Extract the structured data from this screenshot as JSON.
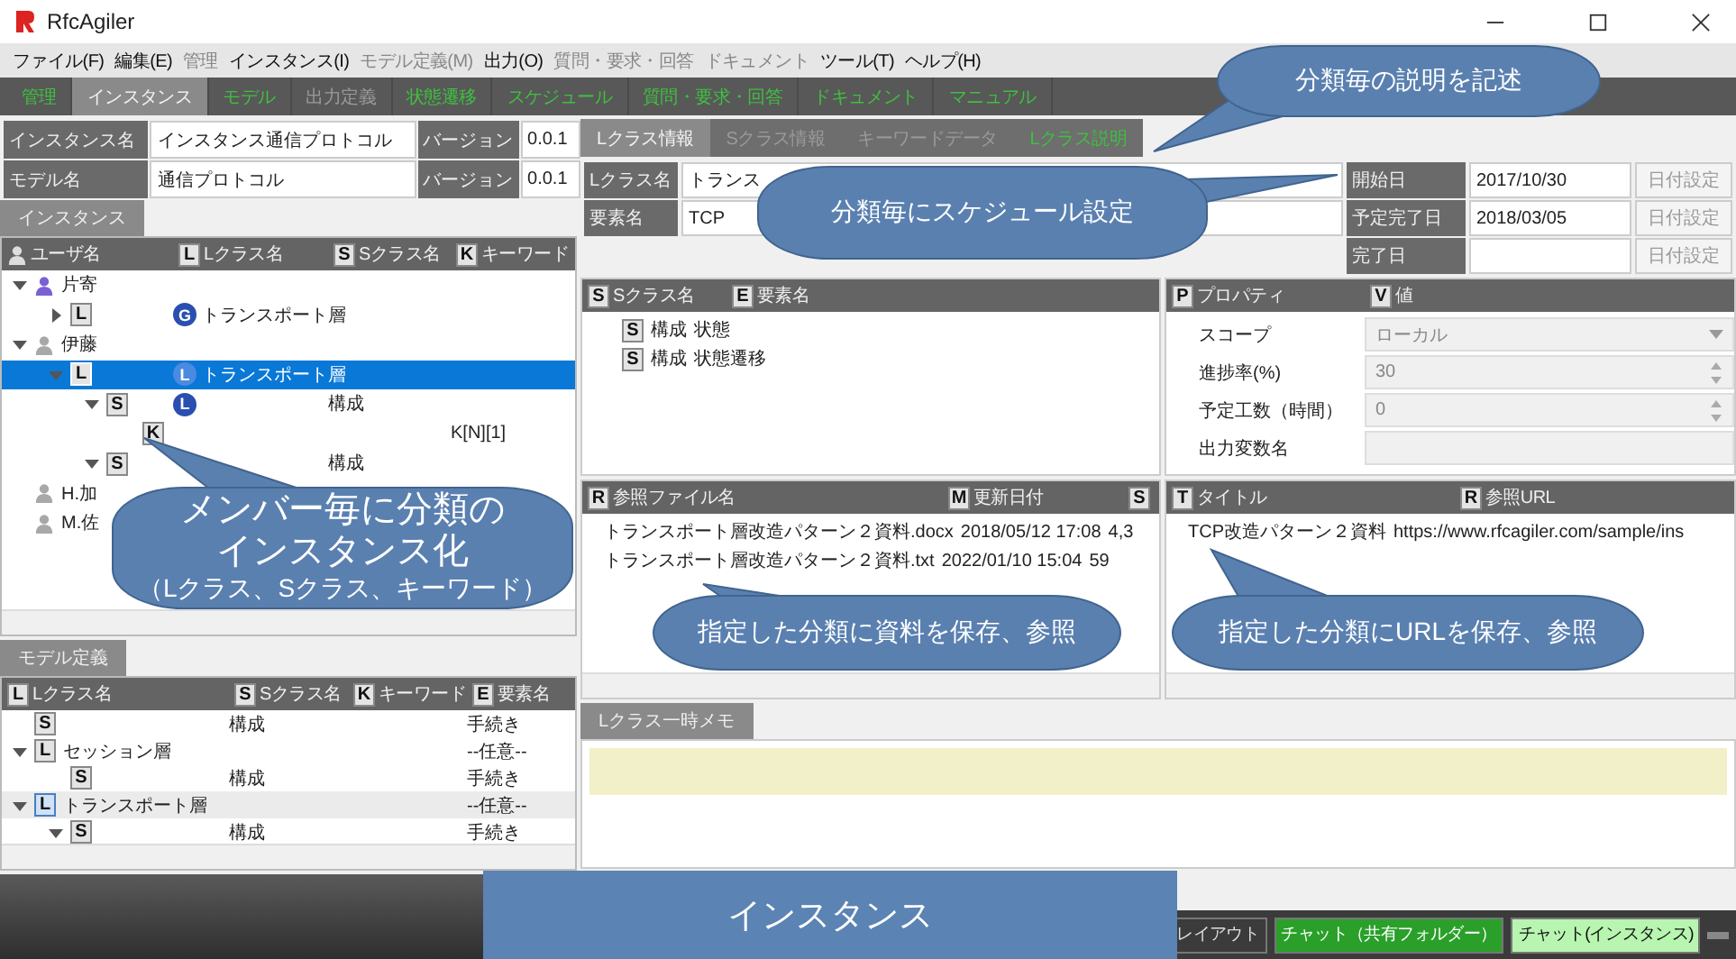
{
  "window": {
    "title": "RfcAgiler"
  },
  "menu": [
    {
      "label": "ファイル(F)",
      "disabled": false
    },
    {
      "label": "編集(E)",
      "disabled": false
    },
    {
      "label": "管理",
      "disabled": true
    },
    {
      "label": "インスタンス(I)",
      "disabled": false
    },
    {
      "label": "モデル定義(M)",
      "disabled": true
    },
    {
      "label": "出力(O)",
      "disabled": false
    },
    {
      "label": "質問・要求・回答",
      "disabled": true
    },
    {
      "label": "ドキュメント",
      "disabled": true
    },
    {
      "label": "ツール(T)",
      "disabled": false
    },
    {
      "label": "ヘルプ(H)",
      "disabled": false
    }
  ],
  "module_tabs": [
    {
      "label": "管理",
      "selected": false,
      "disabled": false
    },
    {
      "label": "インスタンス",
      "selected": true,
      "disabled": false
    },
    {
      "label": "モデル",
      "selected": false,
      "disabled": false
    },
    {
      "label": "出力定義",
      "selected": false,
      "disabled": true
    },
    {
      "label": "状態遷移",
      "selected": false,
      "disabled": false
    },
    {
      "label": "スケジュール",
      "selected": false,
      "disabled": false
    },
    {
      "label": "質問・要求・回答",
      "selected": false,
      "disabled": false
    },
    {
      "label": "ドキュメント",
      "selected": false,
      "disabled": false
    },
    {
      "label": "マニュアル",
      "selected": false,
      "disabled": false
    }
  ],
  "instance_form": [
    {
      "label": "インスタンス名",
      "value": "インスタンス通信プロトコル",
      "version_label": "バージョン",
      "version": "0.0.1"
    },
    {
      "label": "モデル名",
      "value": "通信プロトコル",
      "version_label": "バージョン",
      "version": "0.0.1"
    }
  ],
  "instance_tree": {
    "tab": "インスタンス",
    "columns": [
      {
        "label": "ユーザ名"
      },
      {
        "badge": "L",
        "label": "Lクラス名"
      },
      {
        "badge": "S",
        "label": "Sクラス名"
      },
      {
        "badge": "K",
        "label": "キーワード"
      }
    ],
    "rows": [
      {
        "user": "片寄",
        "color": "#7b5fd4",
        "expanded": true,
        "selected": false,
        "children": [
          {
            "badge": "L",
            "circle": "G",
            "lclass": "トランスポート層",
            "expanded": false,
            "selected": false
          }
        ]
      },
      {
        "user": "伊藤",
        "color": "#a8a8a8",
        "expanded": true,
        "selected": false,
        "children": [
          {
            "badge": "L",
            "circle": "L",
            "lclass": "トランスポート層",
            "expanded": true,
            "selected": true,
            "children": [
              {
                "badge": "S",
                "circle": "L",
                "sclass": "構成",
                "expanded": true,
                "selected": false,
                "children": [
                  {
                    "badge": "K",
                    "keyword": "K[N][1]",
                    "selected": false
                  }
                ]
              },
              {
                "badge": "S",
                "sclass": "構成",
                "expanded": true,
                "selected": false
              }
            ]
          }
        ]
      },
      {
        "user": "H.加",
        "color": "#a8a8a8",
        "selected": false
      },
      {
        "user": "M.佐",
        "color": "#a8a8a8",
        "selected": false
      }
    ]
  },
  "model_tree": {
    "tab": "モデル定義",
    "columns": [
      {
        "badge": "L",
        "label": "Lクラス名"
      },
      {
        "badge": "S",
        "label": "Sクラス名"
      },
      {
        "badge": "K",
        "label": "キーワード"
      },
      {
        "badge": "E",
        "label": "要素名"
      }
    ],
    "rows": [
      {
        "badge": "S",
        "sclass": "構成",
        "element": "手続き",
        "selected": false
      },
      {
        "badge": "L",
        "lclass": "セッション層",
        "element": "--任意--",
        "expanded": true,
        "selected": false,
        "children": [
          {
            "badge": "S",
            "sclass": "構成",
            "element": "手続き",
            "selected": false
          }
        ]
      },
      {
        "badge": "L",
        "lclass": "トランスポート層",
        "element": "--任意--",
        "expanded": true,
        "selected": true,
        "children": [
          {
            "badge": "S",
            "sclass": "構成",
            "element": "手続き",
            "expanded": true,
            "selected": false
          }
        ]
      }
    ]
  },
  "class_tabs": [
    {
      "label": "Lクラス情報",
      "selected": true,
      "disabled": false
    },
    {
      "label": "Sクラス情報",
      "selected": false,
      "disabled": true
    },
    {
      "label": "キーワードデータ",
      "selected": false,
      "disabled": true
    },
    {
      "label": "Lクラス説明",
      "selected": false,
      "disabled": false
    }
  ],
  "class_form": {
    "fields": [
      {
        "label": "Lクラス名",
        "value": "トランス"
      },
      {
        "label": "要素名",
        "value": "TCP"
      }
    ],
    "dates": [
      {
        "label": "開始日",
        "value": "2017/10/30",
        "button": "日付設定",
        "disabled": true
      },
      {
        "label": "予定完了日",
        "value": "2018/03/05",
        "button": "日付設定",
        "disabled": true
      },
      {
        "label": "完了日",
        "button": "日付設定",
        "disabled": true
      }
    ]
  },
  "elements": {
    "columns": [
      {
        "badge": "S",
        "label": "Sクラス名"
      },
      {
        "badge": "E",
        "label": "要素名"
      }
    ],
    "rows": [
      {
        "badge": "S",
        "sclass": "構成",
        "element": "状態"
      },
      {
        "badge": "S",
        "sclass": "構成",
        "element": "状態遷移"
      }
    ]
  },
  "properties": {
    "columns": [
      {
        "badge": "P",
        "label": "プロパティ"
      },
      {
        "badge": "V",
        "label": "値"
      }
    ],
    "rows": [
      {
        "kind": "dropdown",
        "label": "スコープ",
        "value": "ローカル"
      },
      {
        "kind": "spinner",
        "label": "進捗率(%)",
        "value": "30"
      },
      {
        "kind": "spinner",
        "label": "予定工数（時間）",
        "value": "0"
      },
      {
        "kind": "text",
        "label": "出力変数名"
      }
    ]
  },
  "files": {
    "columns": [
      {
        "badge": "R",
        "label": "参照ファイル名"
      },
      {
        "badge": "M",
        "label": "更新日付"
      },
      {
        "badge": "S"
      }
    ],
    "rows": [
      {
        "name": "トランスポート層改造パターン２資料.docx",
        "date": "2018/05/12 17:08",
        "size": "4,3"
      },
      {
        "name": "トランスポート層改造パターン２資料.txt",
        "date": "2022/01/10 15:04",
        "size": "59"
      }
    ]
  },
  "urls": {
    "columns": [
      {
        "badge": "T",
        "label": "タイトル"
      },
      {
        "badge": "R",
        "label": "参照URL"
      }
    ],
    "rows": [
      {
        "title": "TCP改造パターン２資料",
        "url": "https://www.rfcagiler.com/sample/ins"
      }
    ]
  },
  "memo": {
    "tab": "Lクラス一時メモ"
  },
  "status_bar": {
    "buttons": [
      {
        "label": "レイアウト",
        "kind": "plain"
      },
      {
        "label": "チャット（共有フォルダー）",
        "kind": "shared"
      },
      {
        "label": "チャット(インスタンス)",
        "kind": "instance"
      }
    ]
  },
  "callouts": [
    {
      "lines": [
        "分類毎の説明を記述"
      ]
    },
    {
      "lines": [
        "分類毎にスケジュール設定"
      ]
    },
    {
      "lines": [
        "メンバー毎に分類の",
        "インスタンス化"
      ],
      "note": "（Lクラス、Sクラス、キーワード）"
    },
    {
      "lines": [
        "指定した分類に資料を保存、参照"
      ]
    },
    {
      "lines": [
        "指定した分類にURLを保存、参照"
      ]
    }
  ],
  "caption": "インスタンス"
}
